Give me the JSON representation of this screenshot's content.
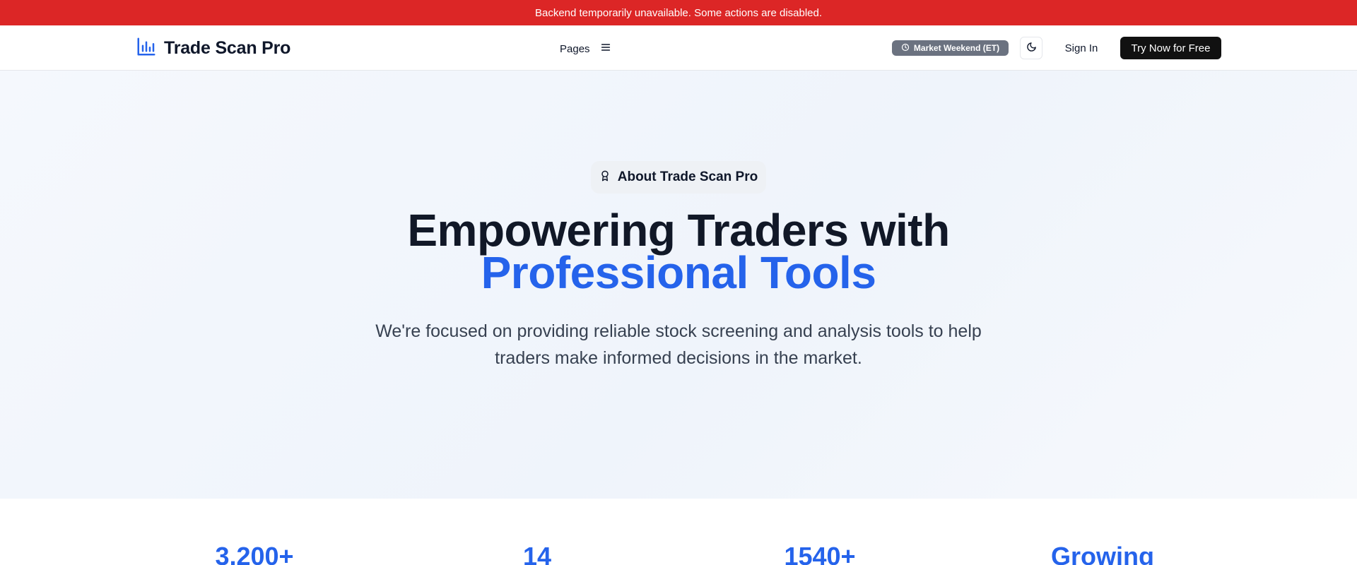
{
  "banner": {
    "message": "Backend temporarily unavailable. Some actions are disabled."
  },
  "header": {
    "brand": "Trade Scan Pro",
    "brand_icon": "bar-chart-icon",
    "pages_label": "Pages",
    "pages_icon": "menu-icon",
    "market_status": "Market Weekend (ET)",
    "market_icon": "clock-icon",
    "theme_icon": "moon-icon",
    "sign_in": "Sign In",
    "cta": "Try Now for Free"
  },
  "hero": {
    "badge_icon": "award-icon",
    "badge_label": "About Trade Scan Pro",
    "headline_line1": "Empowering Traders with",
    "headline_line2": "Professional Tools",
    "subtitle": "We're focused on providing reliable stock screening and analysis tools to help traders make informed decisions in the market."
  },
  "stats": [
    {
      "value": "3,200+"
    },
    {
      "value": "14"
    },
    {
      "value": "1540+"
    },
    {
      "value": "Growing"
    }
  ],
  "colors": {
    "banner": "#dc2626",
    "accent": "#2563eb",
    "cta_background": "#111111",
    "market_badge": "#6b7280",
    "heading": "#111827"
  }
}
